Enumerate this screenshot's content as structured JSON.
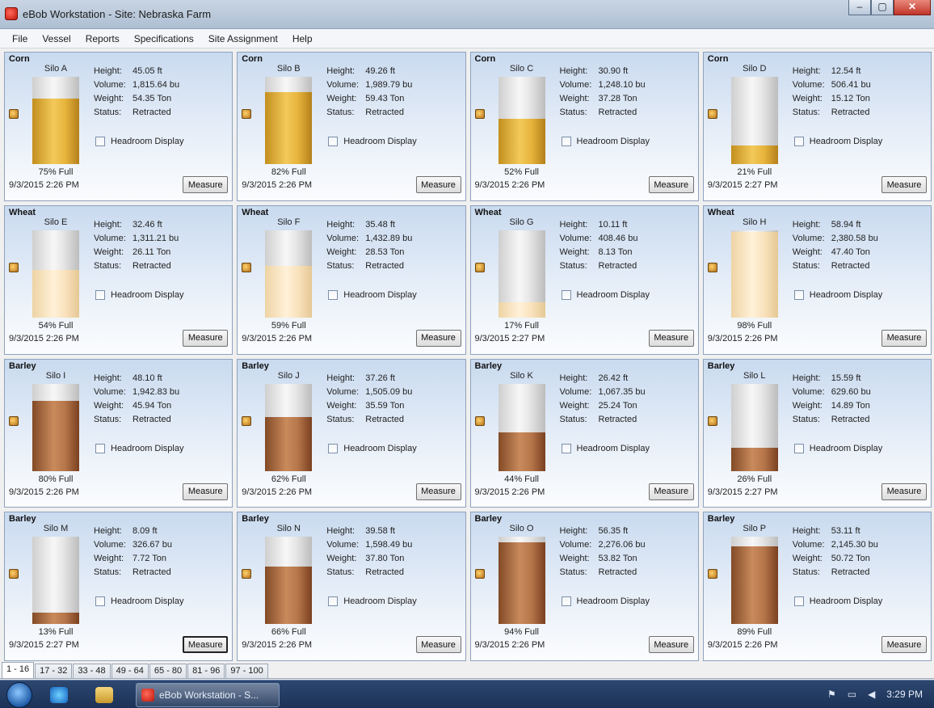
{
  "window": {
    "title": "eBob Workstation - Site: Nebraska Farm",
    "minimize": "–",
    "maximize": "▢",
    "close": "✕"
  },
  "menu": [
    "File",
    "Vessel",
    "Reports",
    "Specifications",
    "Site Assignment",
    "Help"
  ],
  "labels": {
    "height": "Height:",
    "volume": "Volume:",
    "weight": "Weight:",
    "status": "Status:",
    "headroom": "Headroom Display",
    "measure": "Measure"
  },
  "silos": [
    {
      "grain": "Corn",
      "name": "Silo A",
      "height": "45.05 ft",
      "volume": "1,815.64 bu",
      "weight": "54.35 Ton",
      "status": "Retracted",
      "full_pct": 75,
      "full_label": "75% Full",
      "timestamp": "9/3/2015 2:26 PM",
      "kind": "corn"
    },
    {
      "grain": "Corn",
      "name": "Silo B",
      "height": "49.26 ft",
      "volume": "1,989.79 bu",
      "weight": "59.43 Ton",
      "status": "Retracted",
      "full_pct": 82,
      "full_label": "82% Full",
      "timestamp": "9/3/2015 2:26 PM",
      "kind": "corn"
    },
    {
      "grain": "Corn",
      "name": "Silo C",
      "height": "30.90 ft",
      "volume": "1,248.10 bu",
      "weight": "37.28 Ton",
      "status": "Retracted",
      "full_pct": 52,
      "full_label": "52% Full",
      "timestamp": "9/3/2015 2:26 PM",
      "kind": "corn"
    },
    {
      "grain": "Corn",
      "name": "Silo D",
      "height": "12.54 ft",
      "volume": "506.41 bu",
      "weight": "15.12 Ton",
      "status": "Retracted",
      "full_pct": 21,
      "full_label": "21% Full",
      "timestamp": "9/3/2015 2:27 PM",
      "kind": "corn"
    },
    {
      "grain": "Wheat",
      "name": "Silo E",
      "height": "32.46 ft",
      "volume": "1,311.21 bu",
      "weight": "26.11 Ton",
      "status": "Retracted",
      "full_pct": 54,
      "full_label": "54% Full",
      "timestamp": "9/3/2015 2:26 PM",
      "kind": "wheat"
    },
    {
      "grain": "Wheat",
      "name": "Silo F",
      "height": "35.48 ft",
      "volume": "1,432.89 bu",
      "weight": "28.53 Ton",
      "status": "Retracted",
      "full_pct": 59,
      "full_label": "59% Full",
      "timestamp": "9/3/2015 2:26 PM",
      "kind": "wheat"
    },
    {
      "grain": "Wheat",
      "name": "Silo G",
      "height": "10.11 ft",
      "volume": "408.46 bu",
      "weight": "8.13 Ton",
      "status": "Retracted",
      "full_pct": 17,
      "full_label": "17% Full",
      "timestamp": "9/3/2015 2:27 PM",
      "kind": "wheat"
    },
    {
      "grain": "Wheat",
      "name": "Silo H",
      "height": "58.94 ft",
      "volume": "2,380.58 bu",
      "weight": "47.40 Ton",
      "status": "Retracted",
      "full_pct": 98,
      "full_label": "98% Full",
      "timestamp": "9/3/2015 2:26 PM",
      "kind": "wheat"
    },
    {
      "grain": "Barley",
      "name": "Silo I",
      "height": "48.10 ft",
      "volume": "1,942.83 bu",
      "weight": "45.94 Ton",
      "status": "Retracted",
      "full_pct": 80,
      "full_label": "80% Full",
      "timestamp": "9/3/2015 2:26 PM",
      "kind": "barley"
    },
    {
      "grain": "Barley",
      "name": "Silo J",
      "height": "37.26 ft",
      "volume": "1,505.09 bu",
      "weight": "35.59 Ton",
      "status": "Retracted",
      "full_pct": 62,
      "full_label": "62% Full",
      "timestamp": "9/3/2015 2:26 PM",
      "kind": "barley"
    },
    {
      "grain": "Barley",
      "name": "Silo K",
      "height": "26.42 ft",
      "volume": "1,067.35 bu",
      "weight": "25.24 Ton",
      "status": "Retracted",
      "full_pct": 44,
      "full_label": "44% Full",
      "timestamp": "9/3/2015 2:26 PM",
      "kind": "barley"
    },
    {
      "grain": "Barley",
      "name": "Silo L",
      "height": "15.59 ft",
      "volume": "629.60 bu",
      "weight": "14.89 Ton",
      "status": "Retracted",
      "full_pct": 26,
      "full_label": "26% Full",
      "timestamp": "9/3/2015 2:27 PM",
      "kind": "barley"
    },
    {
      "grain": "Barley",
      "name": "Silo M",
      "height": "8.09 ft",
      "volume": "326.67 bu",
      "weight": "7.72 Ton",
      "status": "Retracted",
      "full_pct": 13,
      "full_label": "13% Full",
      "timestamp": "9/3/2015 2:27 PM",
      "kind": "barley"
    },
    {
      "grain": "Barley",
      "name": "Silo N",
      "height": "39.58 ft",
      "volume": "1,598.49 bu",
      "weight": "37.80 Ton",
      "status": "Retracted",
      "full_pct": 66,
      "full_label": "66% Full",
      "timestamp": "9/3/2015 2:26 PM",
      "kind": "barley"
    },
    {
      "grain": "Barley",
      "name": "Silo O",
      "height": "56.35 ft",
      "volume": "2,276.06 bu",
      "weight": "53.82 Ton",
      "status": "Retracted",
      "full_pct": 94,
      "full_label": "94% Full",
      "timestamp": "9/3/2015 2:26 PM",
      "kind": "barley"
    },
    {
      "grain": "Barley",
      "name": "Silo P",
      "height": "53.11 ft",
      "volume": "2,145.30 bu",
      "weight": "50.72 Ton",
      "status": "Retracted",
      "full_pct": 89,
      "full_label": "89% Full",
      "timestamp": "9/3/2015 2:26 PM",
      "kind": "barley"
    }
  ],
  "page_tabs": [
    "1 - 16",
    "17 - 32",
    "33 - 48",
    "49 - 64",
    "65 - 80",
    "81 - 96",
    "97 - 100"
  ],
  "active_page_tab": "1 - 16",
  "taskbar": {
    "task_label": "eBob Workstation - S...",
    "clock": "3:29 PM"
  },
  "icons": {
    "app": "ebob-app-icon",
    "sensor": "sensor-icon",
    "start": "windows-start-icon"
  }
}
